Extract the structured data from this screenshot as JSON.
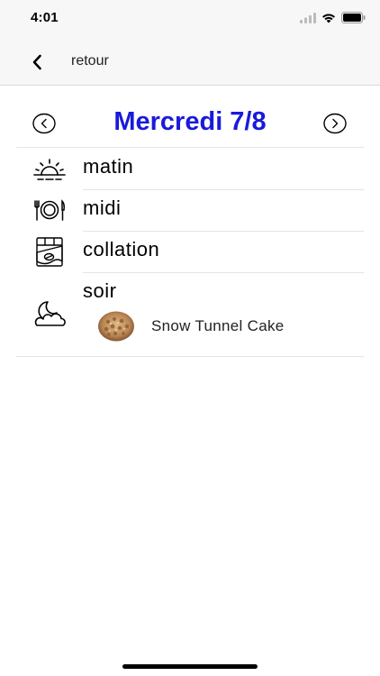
{
  "status_bar": {
    "time": "4:01"
  },
  "nav": {
    "back_label": "retour"
  },
  "day": {
    "title": "Mercredi 7/8"
  },
  "meals": [
    {
      "label": "matin",
      "icon": "sunrise-icon"
    },
    {
      "label": "midi",
      "icon": "plate-cutlery-icon"
    },
    {
      "label": "collation",
      "icon": "chocolate-bar-icon"
    },
    {
      "label": "soir",
      "icon": "moon-cloud-icon",
      "recipes": [
        {
          "name": "Snow Tunnel Cake"
        }
      ]
    }
  ],
  "colors": {
    "title": "#1a1adb",
    "bar_bg": "#f7f7f7",
    "divider": "#e4e4e4"
  }
}
